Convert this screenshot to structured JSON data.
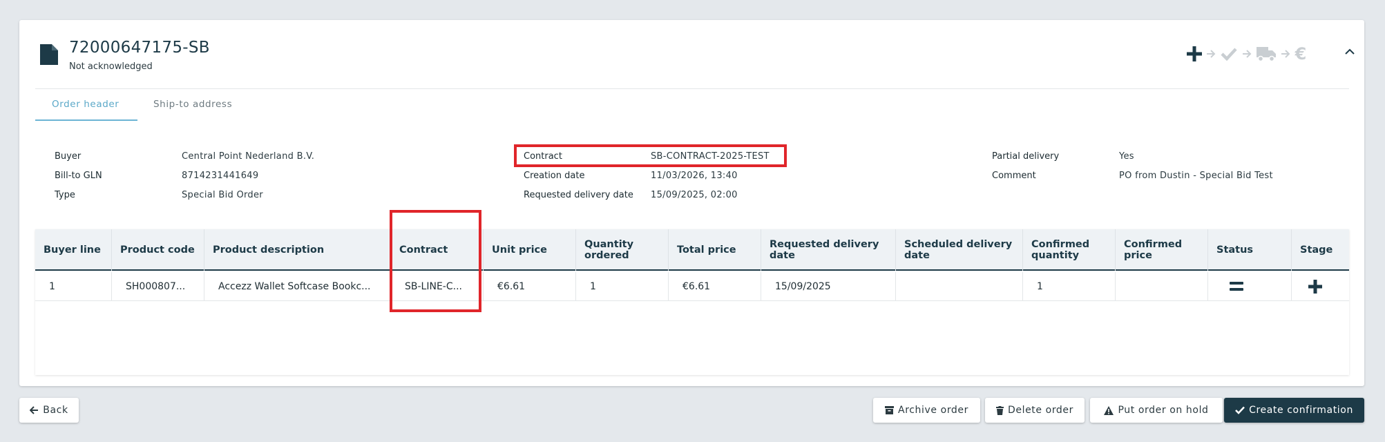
{
  "order": {
    "number": "72000647175-SB",
    "status": "Not acknowledged"
  },
  "stages": [
    "plus-icon",
    "check-icon",
    "truck-icon",
    "euro-icon"
  ],
  "stage_labels": {
    "euro": "€"
  },
  "tabs": [
    "Order header",
    "Ship-to address"
  ],
  "header_fields": {
    "buyer_label": "Buyer",
    "buyer": "Central Point Nederland B.V.",
    "gln_label": "Bill-to GLN",
    "gln": "8714231441649",
    "type_label": "Type",
    "type": "Special Bid Order",
    "contract_label": "Contract",
    "contract": "SB-CONTRACT-2025-TEST",
    "creation_label": "Creation date",
    "creation": "11/03/2026, 13:40",
    "req_label": "Requested delivery date",
    "req": "15/09/2025, 02:00",
    "partial_label": "Partial delivery",
    "partial": "Yes",
    "comment_label": "Comment",
    "comment": "PO from Dustin - Special Bid Test"
  },
  "table": {
    "columns": [
      "Buyer line",
      "Product code",
      "Product description",
      "Contract",
      "Unit price",
      "Quantity ordered",
      "Total price",
      "Requested delivery date",
      "Scheduled delivery date",
      "Confirmed quantity",
      "Confirmed price",
      "Status",
      "Stage"
    ],
    "rows": [
      {
        "buyer_line": "1",
        "product_code": "SH000807...",
        "product_description": "Accezz Wallet Softcase Bookc...",
        "contract": "SB-LINE-C...",
        "unit_price": "€6.61",
        "quantity_ordered": "1",
        "total_price": "€6.61",
        "requested_delivery_date": "15/09/2025",
        "scheduled_delivery_date": "",
        "confirmed_quantity": "1",
        "confirmed_price": ""
      }
    ]
  },
  "footer": {
    "back": "Back",
    "archive": "Archive order",
    "delete": "Delete order",
    "hold": "Put order on hold",
    "confirm": "Create confirmation"
  },
  "colors": {
    "primary": "#1d3a47",
    "tab_active": "#5aa8c8",
    "highlight": "#e0252a"
  }
}
